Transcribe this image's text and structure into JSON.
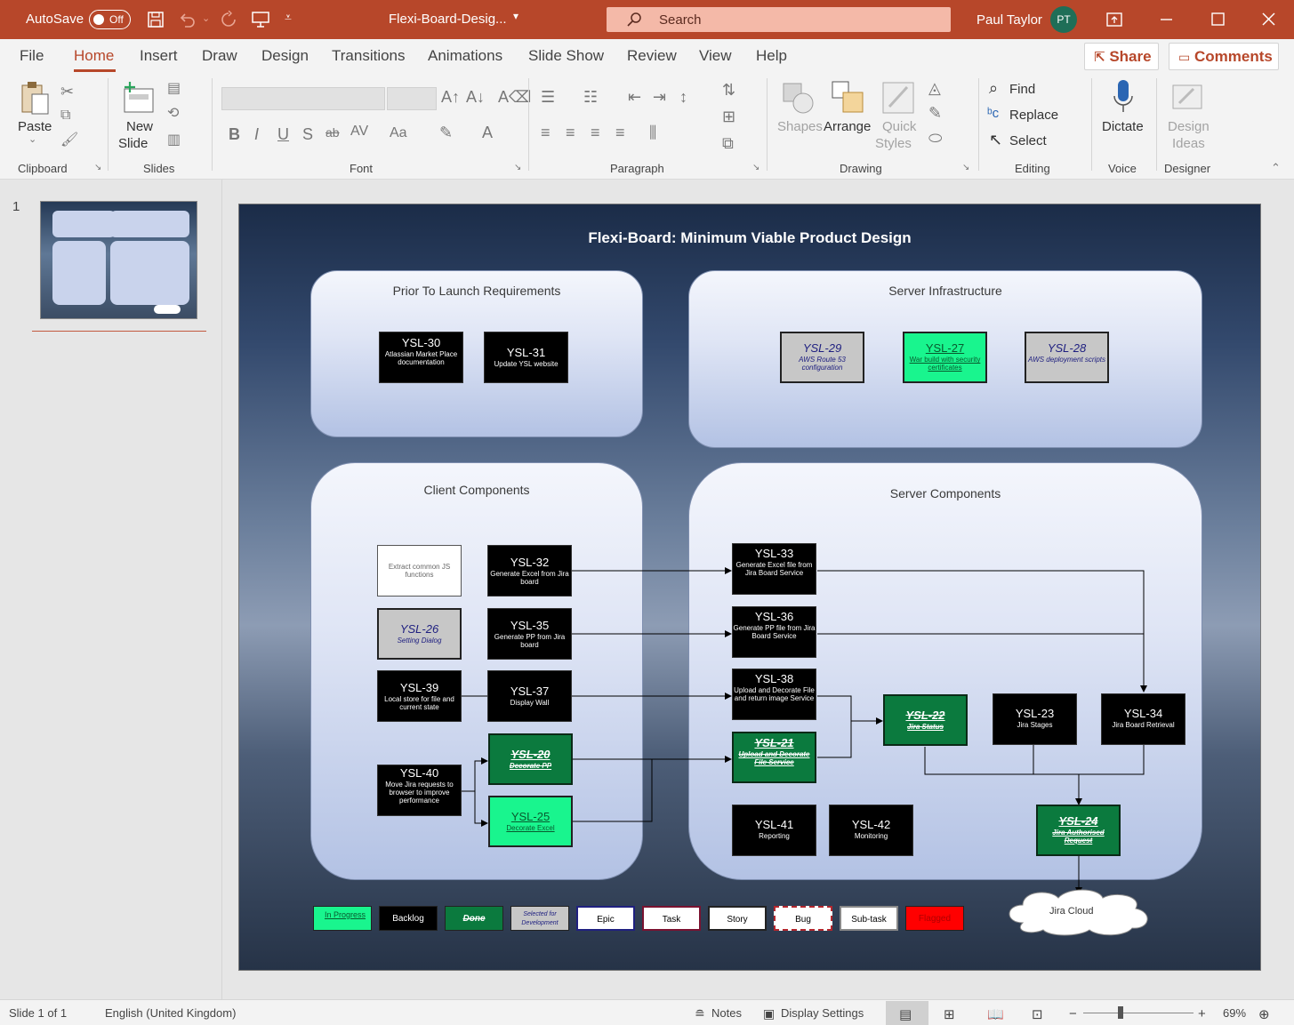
{
  "titlebar": {
    "autosave_label": "AutoSave",
    "autosave_state": "Off",
    "doc_title": "Flexi-Board-Desig...",
    "search_placeholder": "Search",
    "user_name": "Paul Taylor",
    "user_initials": "PT",
    "accent_color": "#b7472a"
  },
  "menu": {
    "items": [
      "File",
      "Home",
      "Insert",
      "Draw",
      "Design",
      "Transitions",
      "Animations",
      "Slide Show",
      "Review",
      "View",
      "Help"
    ],
    "active": "Home",
    "share_label": "Share",
    "comments_label": "Comments"
  },
  "ribbon": {
    "clipboard": {
      "paste": "Paste",
      "group": "Clipboard"
    },
    "slides": {
      "new_slide_1": "New",
      "new_slide_2": "Slide",
      "group": "Slides"
    },
    "font": {
      "group": "Font"
    },
    "paragraph": {
      "group": "Paragraph"
    },
    "drawing": {
      "shapes": "Shapes",
      "arrange": "Arrange",
      "quick_styles_1": "Quick",
      "quick_styles_2": "Styles",
      "group": "Drawing"
    },
    "editing": {
      "find": "Find",
      "replace": "Replace",
      "select": "Select",
      "group": "Editing"
    },
    "voice": {
      "dictate": "Dictate",
      "group": "Voice"
    },
    "designer": {
      "ideas_1": "Design",
      "ideas_2": "Ideas",
      "group": "Designer"
    }
  },
  "thumbnails": {
    "slide_number": "1"
  },
  "slide": {
    "title": "Flexi-Board: Minimum Viable Product Design",
    "panels": {
      "prior": "Prior To Launch Requirements",
      "infra": "Server Infrastructure",
      "client": "Client Components",
      "server": "Server Components"
    },
    "cards": {
      "ysl30": {
        "key": "YSL-30",
        "summary": "Atlassian Market Place documentation"
      },
      "ysl31": {
        "key": "YSL-31",
        "summary": "Update YSL website"
      },
      "ysl29": {
        "key": "YSL-29",
        "summary": "AWS Route 53 configuration"
      },
      "ysl27": {
        "key": "YSL-27",
        "summary": "War build with security certificates"
      },
      "ysl28": {
        "key": "YSL-28",
        "summary": "AWS deployment scripts"
      },
      "extract": {
        "key": "",
        "summary": "Extract common JS functions"
      },
      "ysl32": {
        "key": "YSL-32",
        "summary": "Generate Excel from Jira board"
      },
      "ysl26": {
        "key": "YSL-26",
        "summary": "Setting Dialog"
      },
      "ysl35": {
        "key": "YSL-35",
        "summary": "Generate PP from Jira board"
      },
      "ysl39": {
        "key": "YSL-39",
        "summary": "Local store for file and current state"
      },
      "ysl37": {
        "key": "YSL-37",
        "summary": "Display Wall"
      },
      "ysl40": {
        "key": "YSL-40",
        "summary": "Move Jira requests to browser to improve performance"
      },
      "ysl20": {
        "key": "YSL-20",
        "summary": "Decorate PP"
      },
      "ysl25": {
        "key": "YSL-25",
        "summary": "Decorate Excel"
      },
      "ysl33": {
        "key": "YSL-33",
        "summary": "Generate Excel file from Jira Board Service"
      },
      "ysl36": {
        "key": "YSL-36",
        "summary": "Generate PP file from Jira Board Service"
      },
      "ysl38": {
        "key": "YSL-38",
        "summary": "Upload and Decorate File and return image Service"
      },
      "ysl21": {
        "key": "YSL-21",
        "summary": "Upload and Decorate File Service"
      },
      "ysl22": {
        "key": "YSL-22",
        "summary": "Jira Status"
      },
      "ysl23": {
        "key": "YSL-23",
        "summary": "Jira Stages"
      },
      "ysl34": {
        "key": "YSL-34",
        "summary": "Jira Board Retrieval"
      },
      "ysl41": {
        "key": "YSL-41",
        "summary": "Reporting"
      },
      "ysl42": {
        "key": "YSL-42",
        "summary": "Monitoring"
      },
      "ysl24": {
        "key": "YSL-24",
        "summary": "Jira Authorised Request"
      }
    },
    "cloud_label": "Jira Cloud",
    "legend": [
      "In Progress",
      "Backlog",
      "Done",
      "Selected for Development",
      "Epic",
      "Task",
      "Story",
      "Bug",
      "Sub-task",
      "Flagged"
    ]
  },
  "status": {
    "slide_info": "Slide 1 of 1",
    "language": "English (United Kingdom)",
    "notes": "Notes",
    "display_settings": "Display Settings",
    "zoom": "69%"
  }
}
